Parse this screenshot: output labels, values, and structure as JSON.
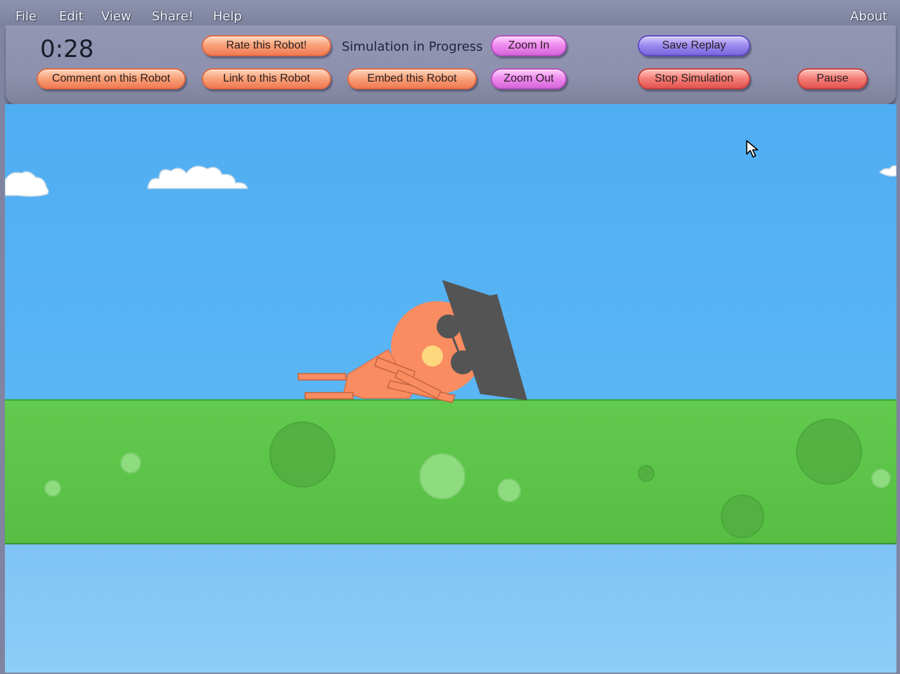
{
  "menu": {
    "items": [
      "File",
      "Edit",
      "View",
      "Share!",
      "Help"
    ],
    "about": "About"
  },
  "panel": {
    "timer": "0:28",
    "status": "Simulation in Progress",
    "buttons": {
      "comment": "Comment on this Robot",
      "rate": "Rate this Robot!",
      "link": "Link to this Robot",
      "embed": "Embed this Robot",
      "zoom_in": "Zoom In",
      "zoom_out": "Zoom Out",
      "save_replay": "Save Replay",
      "stop_simulation": "Stop Simulation",
      "pause": "Pause"
    }
  },
  "colors": {
    "sky": "#55b1f3",
    "ground": "#5cc54a",
    "water": "#86c9f5",
    "robot": "#f98c60",
    "robot_dark": "#545454"
  },
  "icons": {
    "cursor": "mouse-pointer-icon"
  }
}
